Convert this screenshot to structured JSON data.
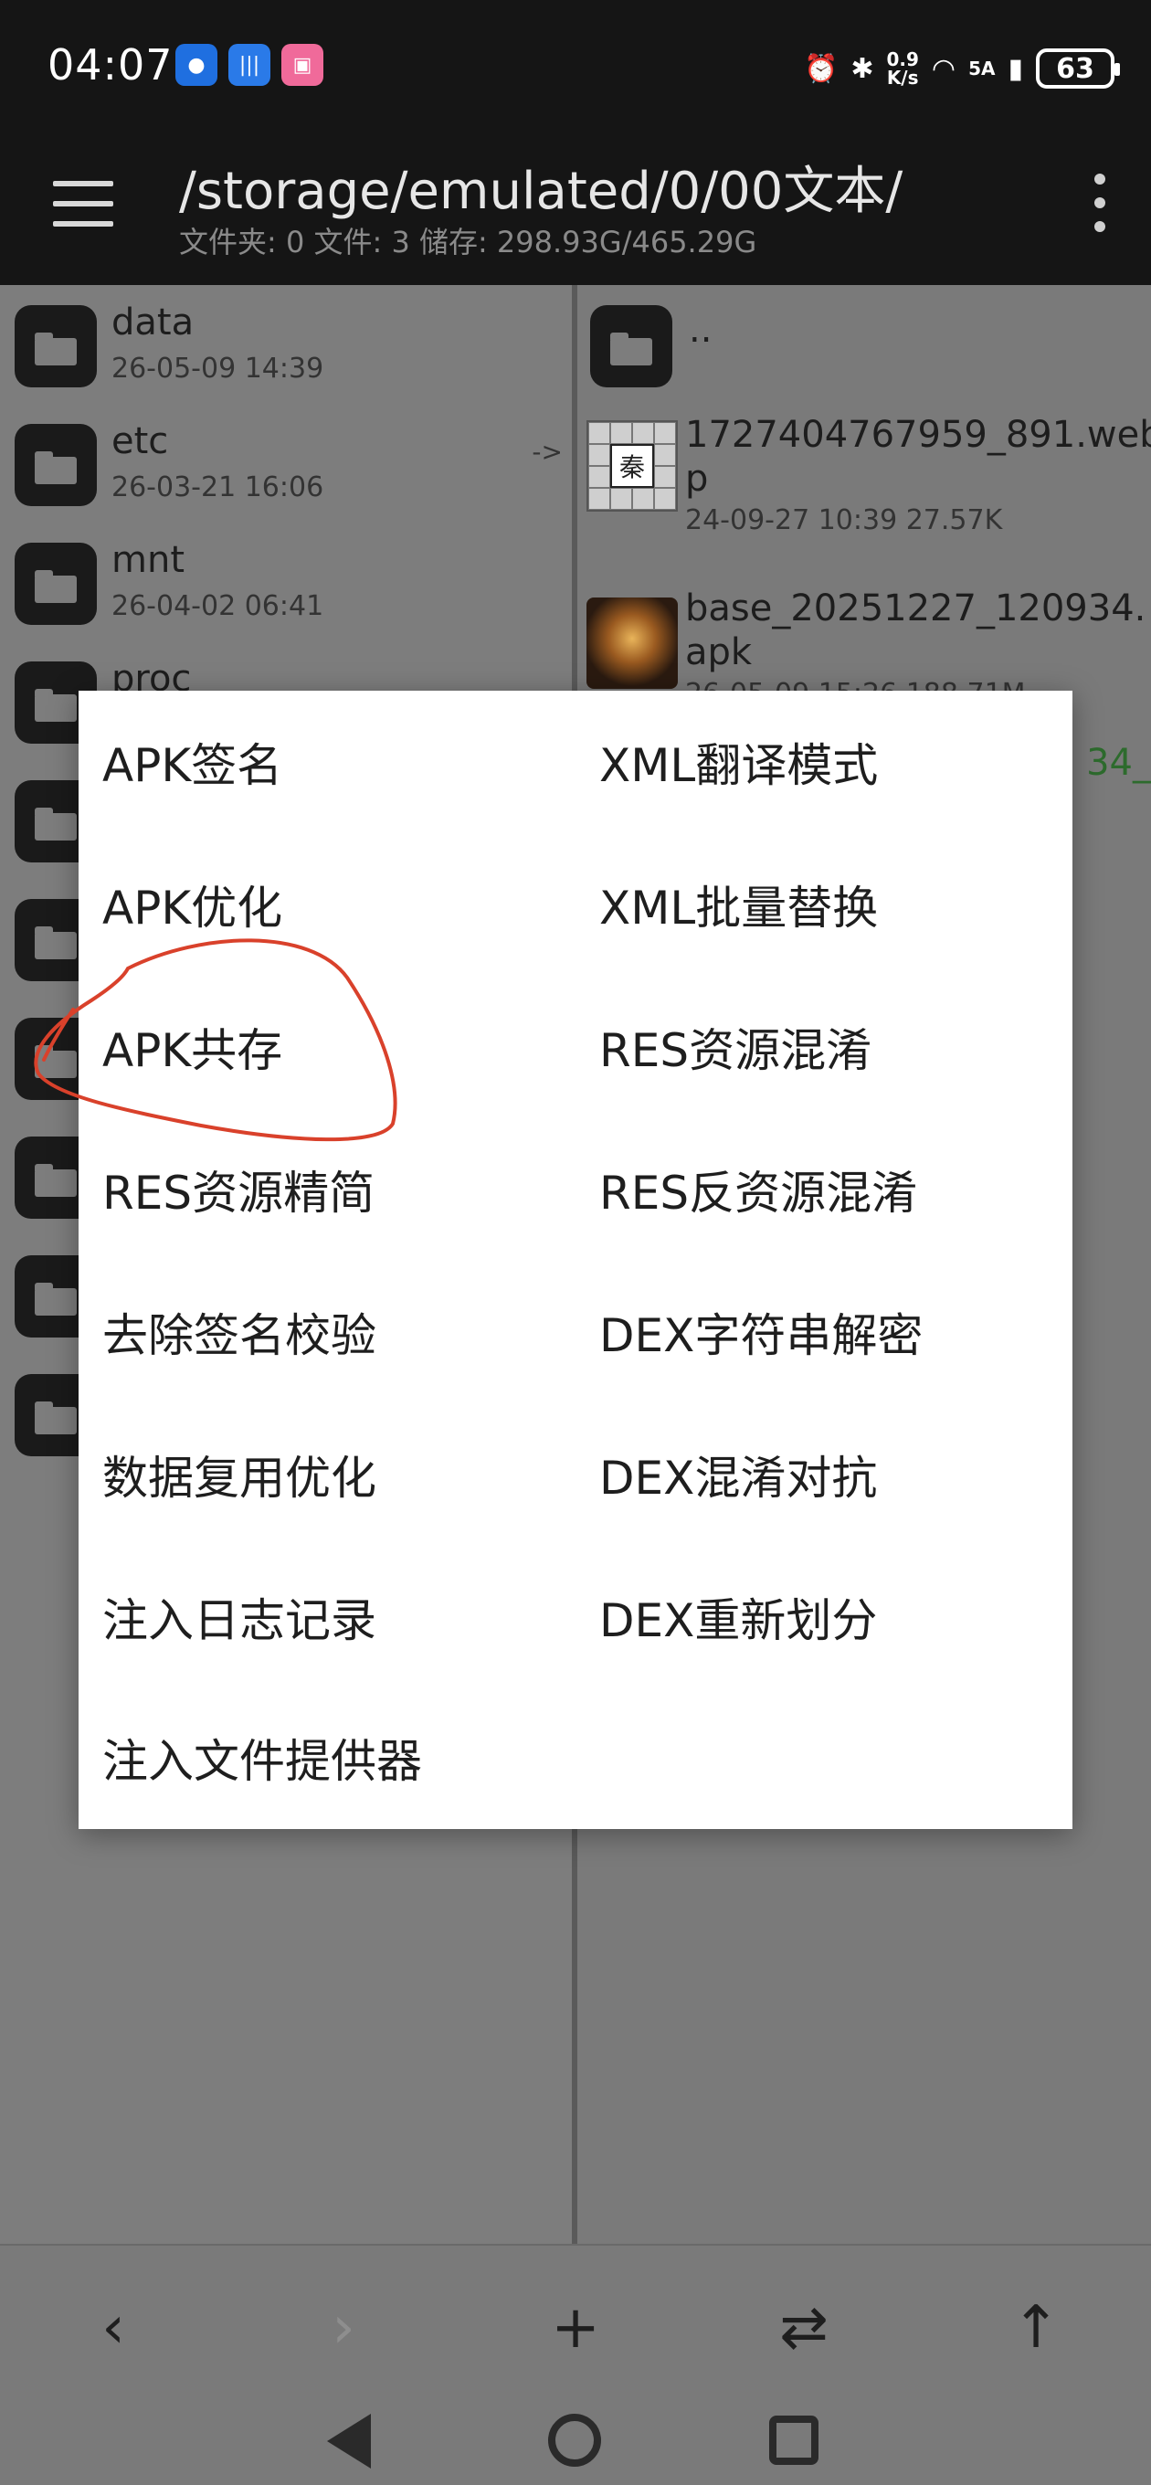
{
  "status_bar": {
    "time": "04:07",
    "notif_icons": [
      "message-icon",
      "voice-icon",
      "bilibili-icon"
    ],
    "speed_top": "0.9",
    "speed_bottom": "K/s",
    "network_label": "5A",
    "battery": "63"
  },
  "toolbar": {
    "path": "/storage/emulated/0/00文本/",
    "summary": "文件夹: 0  文件: 3  储存: 298.93G/465.29G"
  },
  "left_pane": {
    "items": [
      {
        "name": "data",
        "meta": "26-05-09 14:39"
      },
      {
        "name": "etc",
        "meta": "26-03-21 16:06",
        "badge": "->"
      },
      {
        "name": "mnt",
        "meta": "26-04-02 06:41"
      },
      {
        "name": "proc",
        "meta": ""
      }
    ]
  },
  "right_pane": {
    "parent": "..",
    "items": [
      {
        "name_line1": "1727404767959_891.web",
        "name_line2": "p",
        "meta": "24-09-27 10:39  27.57K",
        "thumb_char": "秦"
      },
      {
        "name_line1": "base_20251227_120934.",
        "name_line2": "apk",
        "meta": "26-05-09 15:26  188.71M"
      }
    ],
    "partial_text": "34_"
  },
  "dialog": {
    "left_items": [
      "APK签名",
      "APK优化",
      "APK共存",
      "RES资源精简",
      "去除签名校验",
      "数据复用优化",
      "注入日志记录",
      "注入文件提供器"
    ],
    "right_items": [
      "XML翻译模式",
      "XML批量替换",
      "RES资源混淆",
      "RES反资源混淆",
      "DEX字符串解密",
      "DEX混淆对抗",
      "DEX重新划分"
    ],
    "annotation_color": "#d9412b"
  },
  "bottom_nav": {
    "back": "‹",
    "forward": "›",
    "add": "+",
    "swap": "⇄",
    "up": "↑"
  }
}
